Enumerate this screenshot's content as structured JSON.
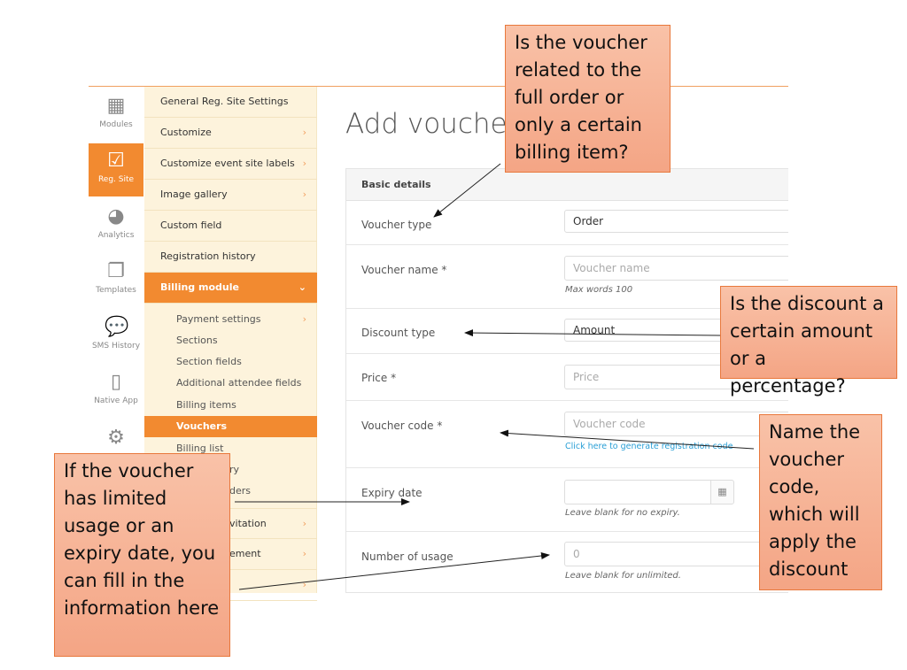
{
  "rail": [
    {
      "label": "Modules",
      "icon": "cubes-icon"
    },
    {
      "label": "Reg. Site",
      "icon": "checkbox-icon",
      "active": true
    },
    {
      "label": "Analytics",
      "icon": "pie-chart-icon"
    },
    {
      "label": "Templates",
      "icon": "files-icon"
    },
    {
      "label": "SMS History",
      "icon": "chat-icon"
    },
    {
      "label": "Native App",
      "icon": "phone-icon"
    },
    {
      "label": "",
      "icon": "gears-icon"
    }
  ],
  "menu": [
    "General Reg. Site Settings",
    "Customize",
    "Customize event site labels",
    "Image gallery",
    "Custom field",
    "Registration history",
    "Billing module"
  ],
  "submenu": [
    "Payment settings",
    "Sections",
    "Section fields",
    "Additional attendee fields",
    "Billing items",
    "Vouchers",
    "Billing list",
    "ry",
    "ders"
  ],
  "menu_lower": [
    "vitation",
    "ement",
    ""
  ],
  "page_title": "Add voucher",
  "panel_title": "Basic details",
  "form": {
    "voucher_type": {
      "label": "Voucher type",
      "value": "Order"
    },
    "voucher_name": {
      "label": "Voucher name *",
      "placeholder": "Voucher name",
      "hint": "Max words 100"
    },
    "discount_type": {
      "label": "Discount type",
      "value": "Amount"
    },
    "price": {
      "label": "Price *",
      "placeholder": "Price"
    },
    "voucher_code": {
      "label": "Voucher code *",
      "placeholder": "Voucher code",
      "link": "Click here to generate registration code"
    },
    "expiry_date": {
      "label": "Expiry date",
      "hint": "Leave blank for no expiry."
    },
    "usage": {
      "label": "Number of usage",
      "placeholder": "0",
      "hint": "Leave blank for unlimited."
    }
  },
  "callouts": {
    "voucher_type": "Is the voucher related to the full order or only a certain billing item?",
    "discount": "Is the discount a certain amount or a percentage?",
    "code": "Name the voucher code, which will apply the discount",
    "limits": "If the voucher has limited usage or an expiry date, you can fill in the information here"
  },
  "colors": {
    "accent": "#f28a30",
    "menu_bg": "#fdf3dc",
    "callout": "#f4a585",
    "callout_border": "#e8783c",
    "link": "#2a9fd6"
  }
}
